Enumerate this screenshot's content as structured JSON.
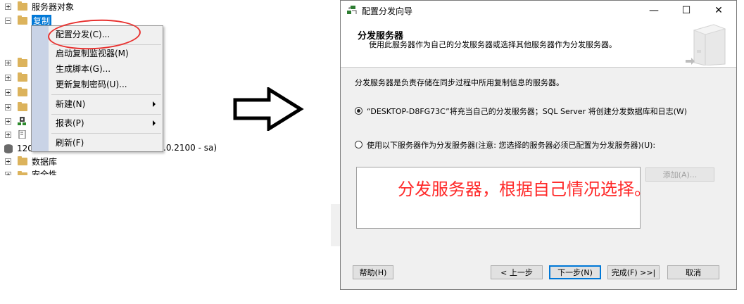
{
  "tree": {
    "items": [
      {
        "label": "服务器对象",
        "expander": "plus"
      },
      {
        "label": "复制",
        "expander": "minus",
        "selected": true
      },
      {
        "label": "",
        "expander": "plus"
      },
      {
        "label": "",
        "expander": "plus"
      },
      {
        "label": "",
        "expander": "plus"
      },
      {
        "label": "",
        "expander": "plus"
      },
      {
        "label": "",
        "expander": "plus"
      },
      {
        "label": "",
        "expander": "plus"
      }
    ],
    "server_prefix": "120",
    "server_suffix": ".0.2100 - sa)",
    "sub_items": [
      {
        "label": "数据库"
      },
      {
        "label": "安全性"
      }
    ]
  },
  "context_menu": {
    "items": [
      {
        "label": "配置分发(C)...",
        "submenu": false
      },
      {
        "label": "启动复制监视器(M)",
        "submenu": false
      },
      {
        "label": "生成脚本(G)...",
        "submenu": false
      },
      {
        "label": "更新复制密码(U)...",
        "submenu": false
      },
      {
        "label": "新建(N)",
        "submenu": true
      },
      {
        "label": "报表(P)",
        "submenu": true
      },
      {
        "label": "刷新(F)",
        "submenu": false
      }
    ],
    "highlight_color": "#e8312f"
  },
  "dialog": {
    "title": "配置分发向导",
    "header_title": "分发服务器",
    "header_subtitle": "使用此服务器作为自己的分发服务器或选择其他服务器作为分发服务器。",
    "description": "分发服务器是负责存储在同步过程中所用复制信息的服务器。",
    "option1": "“DESKTOP-D8FG73C”将充当自己的分发服务器；SQL Server 将创建分发数据库和日志(W)",
    "option2": "使用以下服务器作为分发服务器(注意: 您选择的服务器必须已配置为分发服务器)(U):",
    "add_button": "添加(A)...",
    "annotation": "分发服务器，根据自己情况选择。",
    "annotation_color": "#ff2a2a",
    "buttons": {
      "help": "帮助(H)",
      "back": "< 上一步",
      "next": "下一步(N)",
      "finish": "完成(F) >>|",
      "cancel": "取消"
    },
    "window_controls": {
      "minimize": "—",
      "maximize": "☐",
      "close": "✕"
    }
  }
}
